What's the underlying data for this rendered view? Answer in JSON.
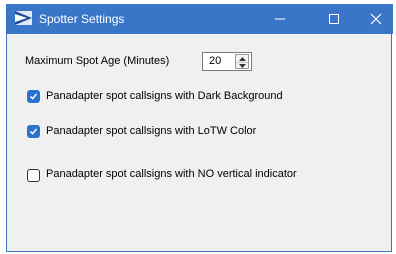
{
  "window": {
    "title": "Spotter Settings",
    "icon": "radio-app-icon",
    "titlebar_color": "#3a76c8"
  },
  "settings": {
    "max_spot_age_label": "Maximum Spot Age (Minutes)",
    "max_spot_age_value": "20",
    "checkboxes": [
      {
        "label": "Panadapter spot callsigns with Dark Background",
        "checked": true
      },
      {
        "label": "Panadapter spot callsigns with LoTW Color",
        "checked": true
      },
      {
        "label": "Panadapter spot callsigns with NO vertical indicator",
        "checked": false
      }
    ]
  }
}
